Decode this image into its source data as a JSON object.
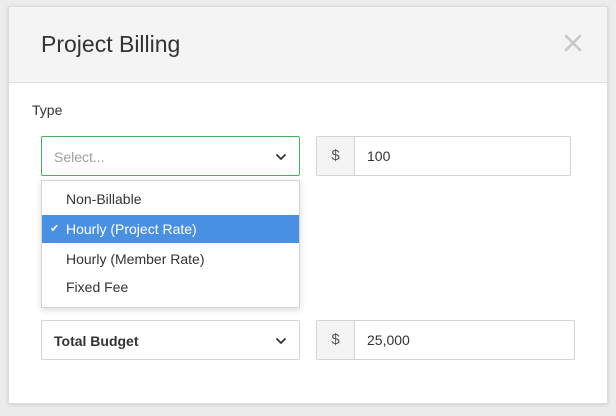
{
  "modal": {
    "title": "Project Billing",
    "close_icon": "close-icon"
  },
  "type_field": {
    "label": "Type",
    "placeholder": "Select...",
    "options": [
      {
        "label": "Non-Billable",
        "selected": false
      },
      {
        "label": "Hourly (Project Rate)",
        "selected": true
      },
      {
        "label": "Hourly (Member Rate)",
        "selected": false
      },
      {
        "label": "Fixed Fee",
        "selected": false
      }
    ]
  },
  "rate_field": {
    "prefix": "$",
    "value": "100"
  },
  "budget_field": {
    "selected": "Total Budget",
    "prefix": "$",
    "value": "25,000"
  },
  "colors": {
    "focus_border": "#45b062",
    "option_highlight": "#4a90e2"
  }
}
